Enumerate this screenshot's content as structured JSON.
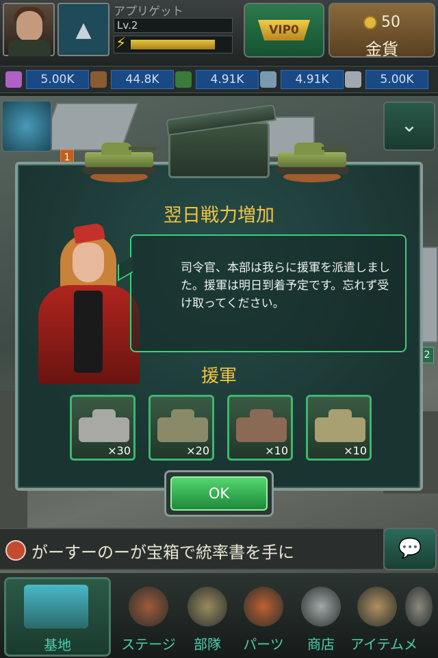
{
  "player": {
    "name": "アプリゲット",
    "level": "Lv.2",
    "xp_fraction": 0.84
  },
  "vip": {
    "label": "VIP0"
  },
  "gold": {
    "amount": "50",
    "label": "金貨"
  },
  "resources": [
    {
      "icon": "crystal-icon",
      "value": "5.00K",
      "color": "#b060c8"
    },
    {
      "icon": "wood-crate-icon",
      "value": "44.8K",
      "color": "#8a5a30"
    },
    {
      "icon": "fuel-can-icon",
      "value": "4.91K",
      "color": "#3a7a3a"
    },
    {
      "icon": "steel-pipe-icon",
      "value": "4.91K",
      "color": "#7a9ab0"
    },
    {
      "icon": "metal-bars-icon",
      "value": "5.00K",
      "color": "#a0a8b0"
    }
  ],
  "dialog": {
    "title": "翌日戦力増加",
    "message": "司令官、本部は我らに援軍を派遣しました。援軍は明日到着予定です。忘れず受け取ってください。",
    "rewards_title": "援軍",
    "rewards": [
      {
        "icon": "heavy-tank-icon",
        "count": "×30",
        "color": "#a8a8a4"
      },
      {
        "icon": "tank-destroyer-icon",
        "count": "×20",
        "color": "#8a8a68"
      },
      {
        "icon": "self-propelled-gun-icon",
        "count": "×10",
        "color": "#8a6a54"
      },
      {
        "icon": "rocket-launcher-icon",
        "count": "×10",
        "color": "#a8a070"
      }
    ],
    "ok_label": "OK"
  },
  "ticker": {
    "text": "がーすーのーが宝箱で統率書を手に"
  },
  "side_badges": [
    "1",
    "2"
  ],
  "nav": {
    "base_label": "基地",
    "items": [
      {
        "label": "ステージ",
        "icon": "crossed-rifles-icon",
        "color": "#a05a3a"
      },
      {
        "label": "部隊",
        "icon": "tank-icon",
        "color": "#9a8a60"
      },
      {
        "label": "パーツ",
        "icon": "wrench-icon",
        "color": "#c06030"
      },
      {
        "label": "商店",
        "icon": "shopping-cart-icon",
        "color": "#a0a8a8"
      },
      {
        "label": "アイテム",
        "icon": "backpack-icon",
        "color": "#b09060"
      },
      {
        "label": "メ",
        "icon": "more-icon",
        "color": "#8a8a80"
      }
    ]
  },
  "colors": {
    "accent_gold": "#f2c440",
    "button_green": "#3cb870",
    "nav_text": "#4acfae"
  }
}
